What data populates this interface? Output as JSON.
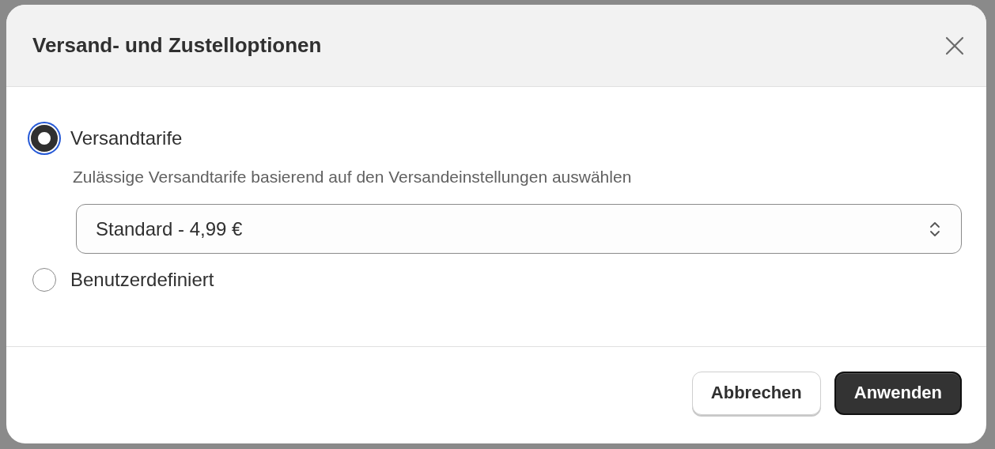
{
  "dialog": {
    "title": "Versand- und Zustelloptionen",
    "options": [
      {
        "label": "Versandtarife",
        "selected": true,
        "description": "Zulässige Versandtarife basierend auf den Versandeinstellungen auswählen",
        "select_value": "Standard - 4,99 €"
      },
      {
        "label": "Benutzerdefiniert",
        "selected": false
      }
    ],
    "buttons": [
      {
        "label": "Abbrechen",
        "kind": "secondary"
      },
      {
        "label": "Anwenden",
        "kind": "primary"
      }
    ]
  }
}
